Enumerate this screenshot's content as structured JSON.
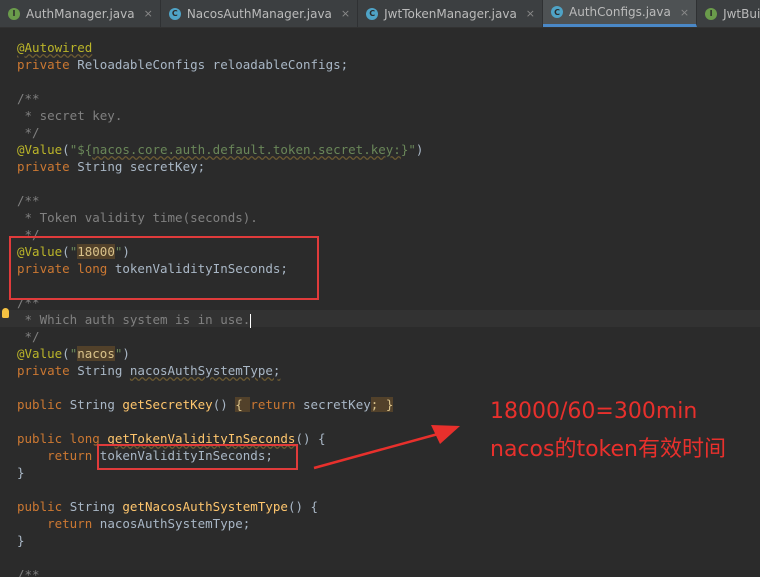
{
  "tabs": [
    {
      "label": "AuthManager.java",
      "icon": "interface-file-icon",
      "glyph": "I"
    },
    {
      "label": "NacosAuthManager.java",
      "icon": "class-file-icon",
      "glyph": "C"
    },
    {
      "label": "JwtTokenManager.java",
      "icon": "class-file-icon",
      "glyph": "C"
    },
    {
      "label": "AuthConfigs.java",
      "icon": "class-file-icon",
      "glyph": "C",
      "active": true
    },
    {
      "label": "JwtBuilde",
      "icon": "interface-file-icon",
      "glyph": "I"
    }
  ],
  "tab_close": "×",
  "code": {
    "l1": "@Autowired",
    "l2a": "private ",
    "l2b": "ReloadableConfigs reloadableConfigs;",
    "l4": "/**",
    "l5": " * secret key.",
    "l6": " */",
    "l7a": "@Value",
    "l7b": "(",
    "l7c": "\"${",
    "l7d": "nacos.core.auth.default.token.secret.key:",
    "l7e": "}\"",
    "l7f": ")",
    "l8a": "private ",
    "l8b": "String secretKey;",
    "l10": "/**",
    "l11": " * Token validity time(seconds).",
    "l12": " */",
    "l13a": "@Value",
    "l13b": "(",
    "l13c": "\"",
    "l13d": "18000",
    "l13e": "\"",
    "l13f": ")",
    "l14a": "private long ",
    "l14b": "tokenValidityInSeconds;",
    "l16": "/**",
    "l17": " * Which auth system is in use.",
    "l18": " */",
    "l19a": "@Value",
    "l19b": "(",
    "l19c": "\"",
    "l19d": "nacos",
    "l19e": "\"",
    "l19f": ")",
    "l20a": "private ",
    "l20b": "String ",
    "l20c": "nacosAuthSystemType;",
    "l22a": "public ",
    "l22b": "String ",
    "l22c": "getSecretKey",
    "l22d": "() ",
    "l22e": "{ ",
    "l22f": "return ",
    "l22g": "secretKey",
    "l22h": "; ",
    "l22i": "}",
    "l24a": "public long ",
    "l24b": "getTokenValidityInSeconds",
    "l24c": "() {",
    "l25a": "    return ",
    "l25b": "tokenValidityInSeconds",
    "l25c": ";",
    "l26": "}",
    "l28a": "public ",
    "l28b": "String ",
    "l28c": "getNacosAuthSystemType",
    "l28d": "() {",
    "l29a": "    return ",
    "l29b": "nacosAuthSystemType",
    "l29c": ";",
    "l30": "}",
    "l32": "/**"
  },
  "annotation": {
    "line1": "18000/60=300min",
    "line2": "nacos的token有效时间"
  },
  "colors": {
    "highlight_box": "#e03b3b",
    "annotation_text": "#e8302c"
  }
}
